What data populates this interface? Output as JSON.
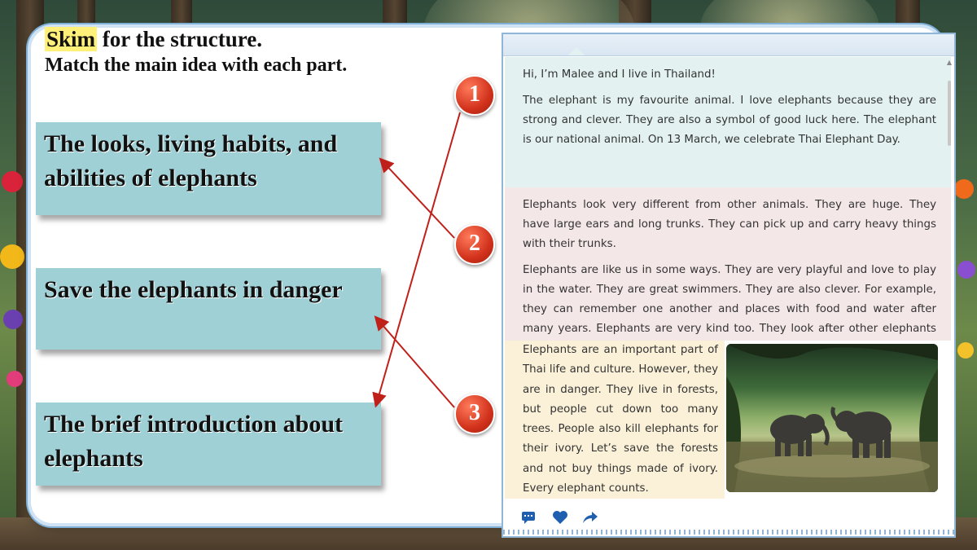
{
  "heading": {
    "skim_word": "Skim",
    "skim_rest": " for the structure.",
    "subtitle": "Match the main idea with each part."
  },
  "main_ideas": [
    {
      "text": "The looks, living habits, and abilities of elephants"
    },
    {
      "text": "Save the elephants in danger"
    },
    {
      "text": "The brief introduction about elephants"
    }
  ],
  "part_numbers": [
    "1",
    "2",
    "3"
  ],
  "reading": {
    "part1": [
      "Hi, I’m Malee and I live in Thailand!",
      "The elephant is my favourite animal. I love elephants because they are strong and clever. They are also a symbol of good luck here. The elephant is our national animal. On 13 March, we celebrate Thai Elephant Day."
    ],
    "part2": [
      "Elephants look very different from other animals. They are huge. They have large ears and long trunks. They can pick up and carry heavy things with their trunks.",
      "Elephants are like us in some ways. They are very playful and love to play in the water. They are great swimmers. They are also clever. For example, they can remember one another and places with food and water after many years. Elephants are very kind too. They look after other elephants when they don’t feel well. The big elephants also help the baby ones."
    ],
    "part3": "Elephants are an important part of Thai life and culture. However, they are in danger. They live in forests, but people cut down too many trees. People also kill elephants for their ivory. Let’s save the forests and not buy things made of ivory. Every elephant counts."
  },
  "colors": {
    "idea_box": "#9fd0d6",
    "arrow": "#c0201a",
    "badge": "#d2321c",
    "part1_bg": "#e3f1f1",
    "part2_bg": "#f4e7e8",
    "part3_bg": "#fbf1d8"
  },
  "icons": [
    "comment-icon",
    "heart-icon",
    "share-icon",
    "elephant-photo"
  ]
}
